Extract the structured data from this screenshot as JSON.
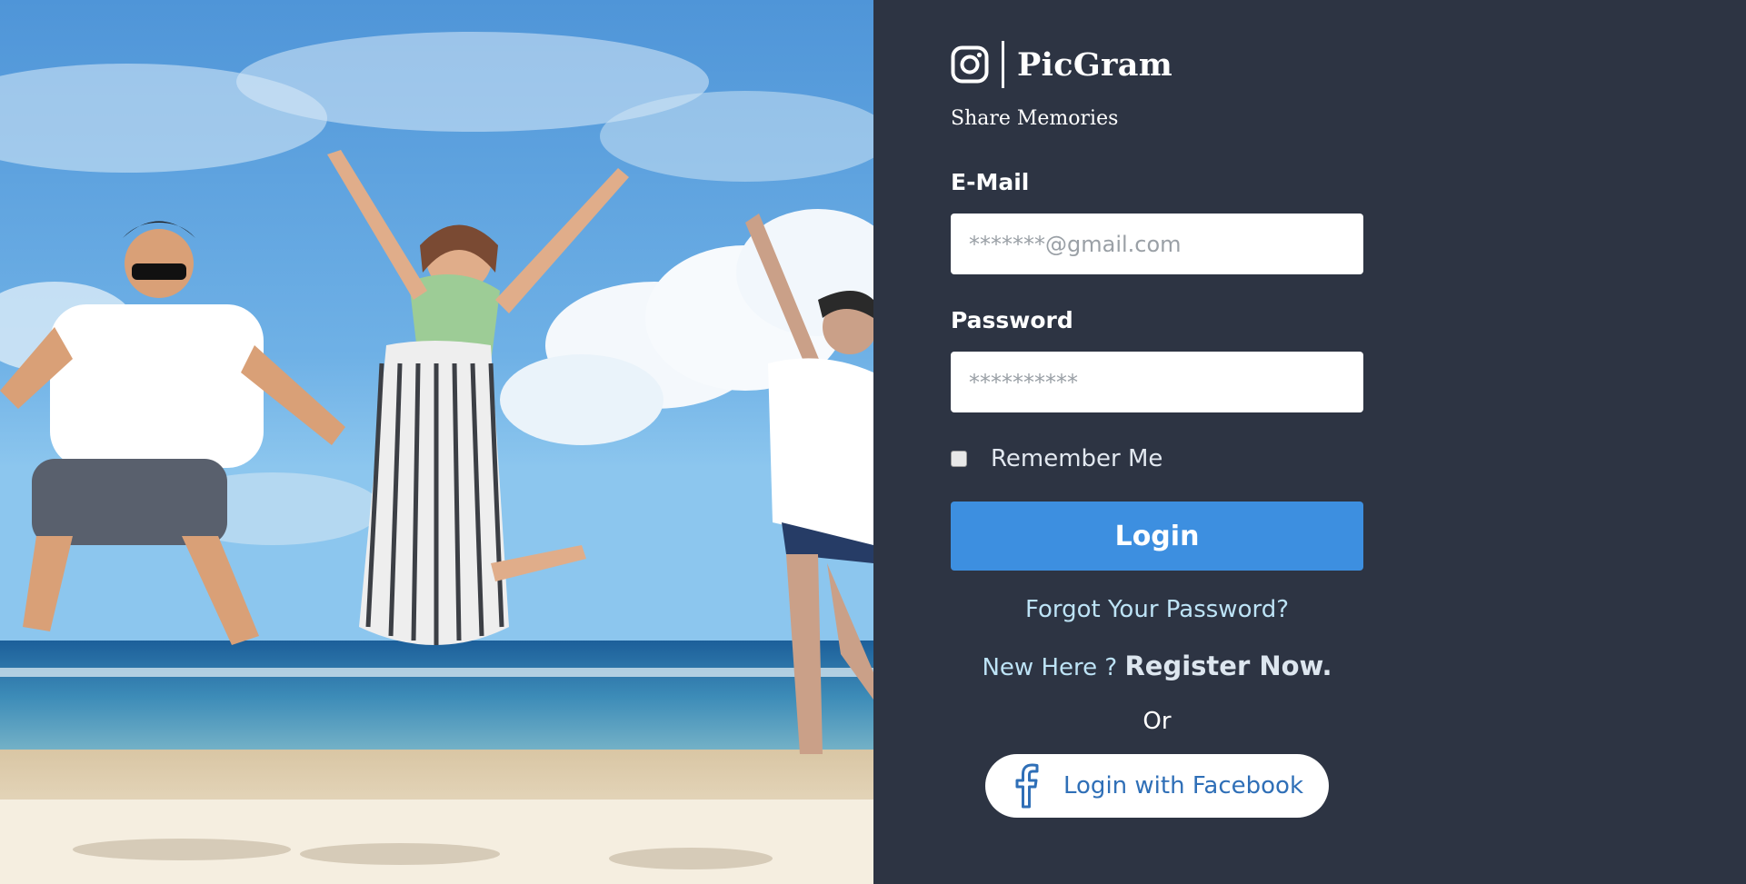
{
  "hero": {
    "image_description_icon": "beach-jump-photo"
  },
  "brand": {
    "name": "PicGram",
    "icon": "instagram-icon",
    "tagline": "Share Memories"
  },
  "form": {
    "email_label": "E-Mail",
    "email_placeholder": "*******@gmail.com",
    "password_label": "Password",
    "password_placeholder": "**********",
    "remember_label": "Remember Me",
    "login_label": "Login",
    "forgot_label": "Forgot Your Password?",
    "new_here_label": "New Here ?",
    "register_label": "Register Now.",
    "or_label": "Or",
    "facebook_label": "Login with Facebook",
    "facebook_icon": "facebook-icon"
  },
  "colors": {
    "panel_bg": "#2d3443",
    "primary": "#3d8fe0",
    "link": "#bde3f6",
    "facebook": "#2f6fb7"
  }
}
